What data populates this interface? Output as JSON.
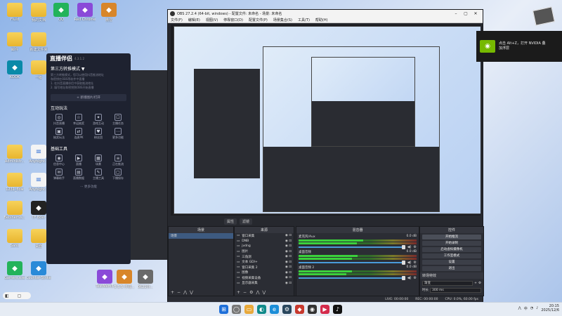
{
  "desktop": {
    "icons": [
      {
        "label": "Fluid",
        "kind": "folder"
      },
      {
        "label": "我的文档",
        "kind": "folder"
      },
      {
        "label": "QQ",
        "kind": "app"
      },
      {
        "label": "Red Chrome",
        "kind": "app"
      },
      {
        "label": "微信",
        "kind": "app"
      },
      {
        "label": "邮件",
        "kind": "folder"
      },
      {
        "label": "新建文件夹",
        "kind": "folder"
      },
      {
        "label": "KOOK",
        "kind": "app"
      },
      {
        "label": "一级",
        "kind": "folder"
      },
      {
        "label": "Administr...",
        "kind": "folder"
      },
      {
        "label": "Anyhight...",
        "kind": "doc"
      },
      {
        "label": "1231_flow",
        "kind": "folder"
      },
      {
        "label": "Anyhight...",
        "kind": "doc"
      },
      {
        "label": "Bebinemis...",
        "kind": "folder"
      },
      {
        "label": "TF Bder",
        "kind": "app"
      },
      {
        "label": "Sano",
        "kind": "folder"
      },
      {
        "label": "桌面",
        "kind": "folder"
      },
      {
        "label": "Counter-Strike Global",
        "kind": "app"
      },
      {
        "label": "Gamers.exe",
        "kind": "app"
      },
      {
        "label": "TestMem5",
        "kind": "app"
      },
      {
        "label": "5 5 5 子母...",
        "kind": "app"
      },
      {
        "label": "0621抖...",
        "kind": "app"
      }
    ]
  },
  "companion": {
    "logo": "直播伴侣",
    "version": "4.3.1.2",
    "mode_title": "第三方转推模式 ▼",
    "hint_lines": [
      "第三方转推模式，您可以使用抖音推流地址",
      "和密钥在OBS等软件中直播",
      "1. 在抖音直播伴侣中获取推流地址",
      "2. 填写地址和密钥到OBS开始直播"
    ],
    "add_button": "+ 新增图片/打开",
    "interactive_title": "互动玩法",
    "interactive_tools": [
      {
        "icon": "◎",
        "label": "抖音直播"
      },
      {
        "label": "幸运抽奖",
        "icon": "☆"
      },
      {
        "label": "游戏互动",
        "icon": "✦"
      },
      {
        "label": "主播任务",
        "icon": "☐"
      },
      {
        "label": "抽奖玩法",
        "icon": "▣"
      },
      {
        "label": "连麦PK",
        "icon": "⇄"
      },
      {
        "label": "粉丝团",
        "icon": "♥"
      },
      {
        "label": "更多功能",
        "icon": "⋯"
      }
    ],
    "basic_title": "基础工具",
    "basic_tools": [
      {
        "label": "信息中心",
        "icon": "◉"
      },
      {
        "label": "直播",
        "icon": "▶"
      },
      {
        "label": "场景",
        "icon": "▦"
      },
      {
        "label": "正在推流",
        "icon": "≡"
      },
      {
        "label": "弹幕助手",
        "icon": "✉"
      },
      {
        "label": "直播数据",
        "icon": "▤"
      },
      {
        "label": "主播工具",
        "icon": "✎"
      },
      {
        "label": "下播保存",
        "icon": "▢"
      }
    ],
    "more_label": "··· 更多功能"
  },
  "obs": {
    "title": "OBS 27.2.4 (64-bit, windows) - 配置文件: 未命名 - 场景: 未命名",
    "menu": [
      "文件(F)",
      "编辑(E)",
      "视图(V)",
      "停靠窗口(D)",
      "配置文件(P)",
      "场景集合(S)",
      "工具(T)",
      "帮助(H)"
    ],
    "preview_tabs": [
      "属性",
      "滤镜"
    ],
    "scenes_label": "场景",
    "scenes": [
      "场景"
    ],
    "sources_label": "来源",
    "sources": [
      "窗口采集",
      "DNB",
      "jvdng",
      "图片",
      "三角测",
      "文本 GDI+",
      "窗口采集 2",
      "图像",
      "视频采集设备",
      "显示器采集"
    ],
    "mixer_label": "混音器",
    "mixer": [
      {
        "name": "麦克风/Aux",
        "db": "0.0 dB",
        "level": 0.55
      },
      {
        "name": "桌面音频",
        "db": "0.0 dB",
        "level": 0.5
      },
      {
        "name": "桌面音频 2",
        "db": "0.0 dB",
        "level": 0.45
      }
    ],
    "transitions_label": "转场特效",
    "transition_type": "渐变",
    "duration_label": "时长",
    "duration_value": "300 ms",
    "controls_label": "控件",
    "controls": [
      "开始推流",
      "开始录制",
      "启动虚拟摄像机",
      "工作室模式",
      "设置",
      "退出"
    ],
    "status": {
      "live": "LIVE: 00:00:00",
      "rec": "REC: 00:00:00",
      "cpu": "CPU: 0.0%, 60.00 fps"
    }
  },
  "nvidia": {
    "line1": "点击 Alt+Z，打开 NVIDIA 叠",
    "line2": "加浮层"
  },
  "taskbar": {
    "clock_time": "20:15",
    "clock_date": "2025/12/6",
    "lang": "中",
    "apps": [
      {
        "icon": "⊞",
        "color": "#1e6fd9"
      },
      {
        "icon": "◯",
        "color": "#777"
      },
      {
        "icon": "▭",
        "color": "#e8a93b"
      },
      {
        "icon": "◐",
        "color": "#0f8a8a"
      },
      {
        "icon": "e",
        "color": "#1c8ed8"
      },
      {
        "icon": "⚙",
        "color": "#2a475e"
      },
      {
        "icon": "◆",
        "color": "#c7392e"
      },
      {
        "icon": "◉",
        "color": "#333"
      },
      {
        "icon": "▶",
        "color": "#d42b4c"
      },
      {
        "icon": "♪",
        "color": "#111"
      }
    ]
  }
}
